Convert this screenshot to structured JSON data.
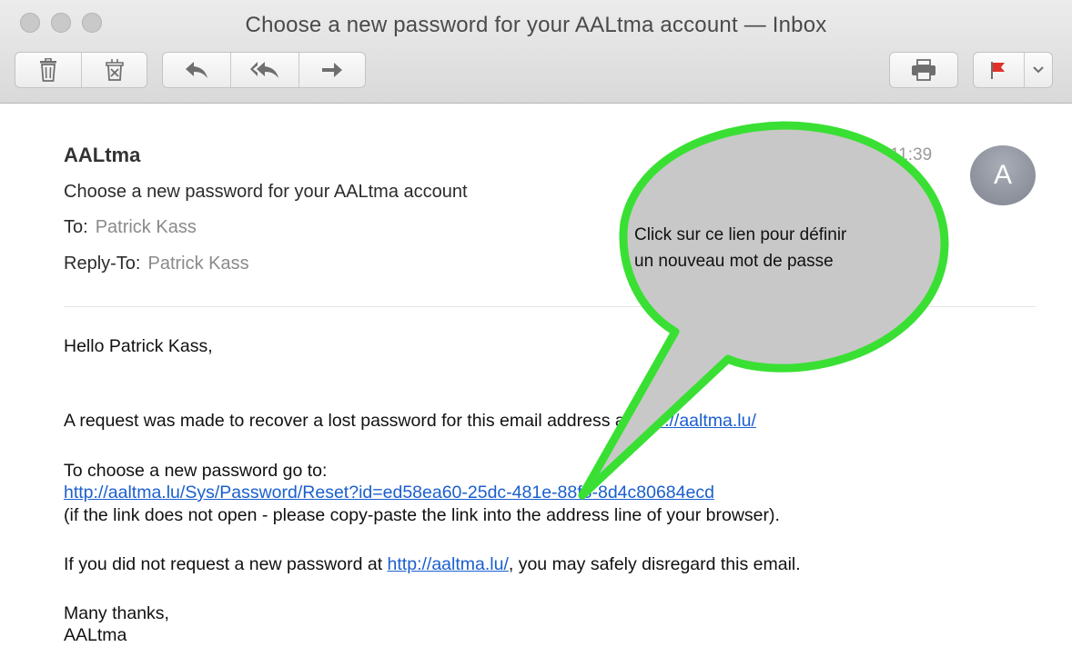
{
  "window": {
    "title": "Choose a new password for your AALtma account — Inbox"
  },
  "toolbar": {
    "delete_icon": "trash-icon",
    "junk_icon": "junk-icon",
    "reply_icon": "reply-icon",
    "reply_all_icon": "reply-all-icon",
    "forward_icon": "forward-icon",
    "print_icon": "printer-icon",
    "flag_icon": "flag-icon",
    "flag_color": "#e0322a"
  },
  "message": {
    "sender": "AALtma",
    "subject": "Choose a new password for your AALtma account",
    "to_label": "To:",
    "to_value": "Patrick Kass",
    "reply_to_label": "Reply-To:",
    "reply_to_value": "Patrick Kass",
    "time": "11:39",
    "avatar_initial": "A"
  },
  "body": {
    "greeting": "Hello Patrick Kass,",
    "request_text": "A request was made to recover a lost password for this email address at ",
    "site_link": "http://aaltma.lu/",
    "choose_text": "To choose a new password go to:",
    "reset_link": "http://aaltma.lu/Sys/Password/Reset?id=ed58ea60-25dc-481e-88f6-8d4c80684ecd",
    "copy_hint": "(if the link does not open - please copy-paste the link into the address line of your browser).",
    "disregard_prefix": "If you did not request a new password at ",
    "disregard_link": "http://aaltma.lu/",
    "disregard_suffix": ", you may safely disregard this email.",
    "thanks": "Many thanks,",
    "signature": "AALtma"
  },
  "callout": {
    "line1": "Click sur ce lien pour définir",
    "line2": "un nouveau mot de passe",
    "border_color": "#39e033",
    "fill_color": "#c8c8c8"
  }
}
